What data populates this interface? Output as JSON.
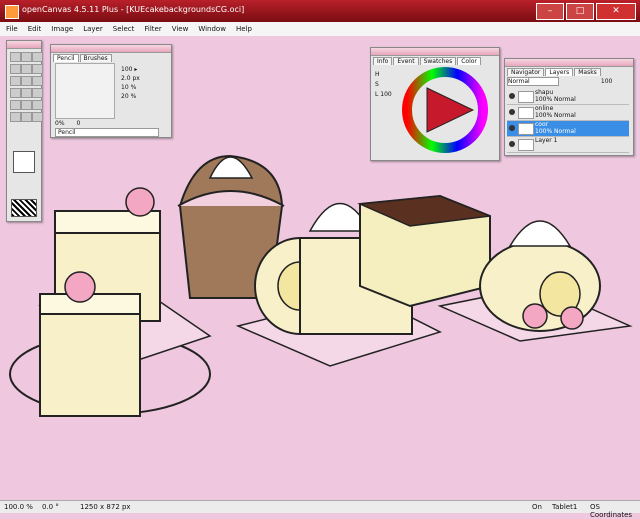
{
  "window": {
    "title": "openCanvas 4.5.11 Plus - [KUEcakebackgroundsCG.oci]"
  },
  "menu": [
    "File",
    "Edit",
    "Image",
    "Layer",
    "Select",
    "Filter",
    "View",
    "Window",
    "Help"
  ],
  "brush_panel": {
    "tab_pencil": "Pencil",
    "tab_brushes": "Brushes",
    "row1": "100",
    "row2": "2.0",
    "row2_unit": "px",
    "row3": "10",
    "row3_unit": "%",
    "row4": "20",
    "row4_unit": "%",
    "opacity_a": "0%",
    "opacity_b": "0",
    "brush_name": "Pencil"
  },
  "color_panel": {
    "tabs": [
      "Info",
      "Event",
      "Swatches",
      "Color"
    ],
    "h_label": "H",
    "s_label": "S",
    "l_label": "L",
    "l_value": "100"
  },
  "layers_panel": {
    "tabs": [
      "Navigator",
      "Layers",
      "Masks"
    ],
    "blend_mode": "Normal",
    "opacity": "100",
    "layers": [
      {
        "name": "shapu",
        "mode": "100% Normal"
      },
      {
        "name": "online",
        "mode": "100% Normal"
      },
      {
        "name": "coor",
        "mode": "100% Normal"
      },
      {
        "name": "Layer 1",
        "mode": ""
      }
    ]
  },
  "status": {
    "zoom": "100.0 %",
    "rotation": "0.0 °",
    "size": "1250 x 872 px",
    "on": "On",
    "tablet": "Tablet1",
    "coords": "OS Coordinates"
  }
}
